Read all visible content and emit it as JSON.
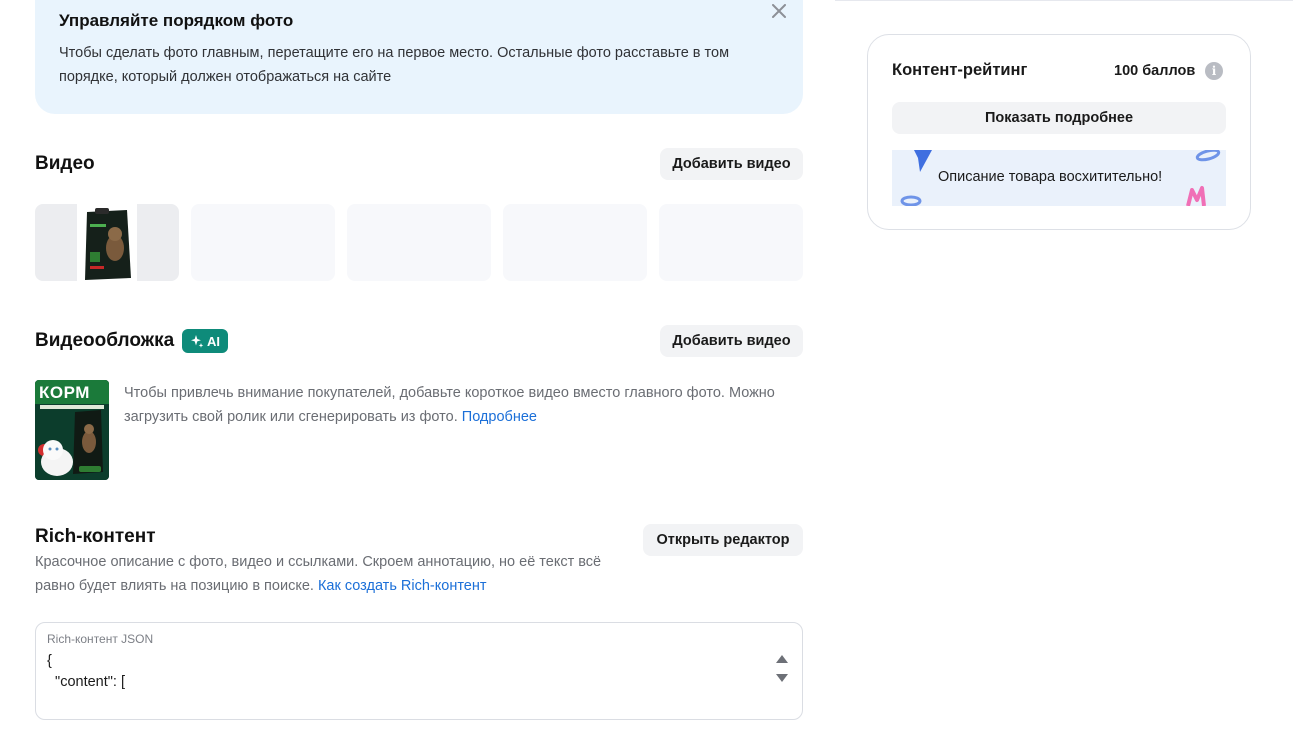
{
  "banner": {
    "title": "Управляйте порядком фото",
    "text": "Чтобы сделать фото главным, перетащите его на первое место. Остальные фото расставьте в том порядке, который должен отображаться на сайте",
    "close_icon": "close-icon"
  },
  "video": {
    "title": "Видео",
    "add_button": "Добавить видео"
  },
  "video_cover": {
    "title": "Видеообложка",
    "ai_badge": "AI",
    "add_button": "Добавить видео",
    "description": "Чтобы привлечь внимание покупателей, добавьте короткое видео вместо главного фото. Можно загрузить свой ролик или сгенерировать из фото.",
    "link": "Подробнее",
    "thumb_text": "КОРМ"
  },
  "rich_content": {
    "title": "Rich-контент",
    "open_editor_button": "Открыть редактор",
    "description": "Красочное описание с фото, видео и ссылками. Скроем аннотацию, но её текст всё равно будет влиять на позицию в поиске.",
    "link": "Как создать Rich-контент",
    "json_field": {
      "label": "Rich-контент JSON",
      "value": "{\n  \"content\": ["
    }
  },
  "content_rating": {
    "title": "Контент-рейтинг",
    "score": "100 баллов",
    "info_icon": "info-icon",
    "more_button": "Показать подробнее",
    "message": "Описание товара восхитительно!"
  },
  "colors": {
    "banner_bg": "#e9f4fd",
    "accent_teal": "#0e8b7a",
    "link_blue": "#1b6fd8",
    "button_bg": "#f2f3f5"
  }
}
